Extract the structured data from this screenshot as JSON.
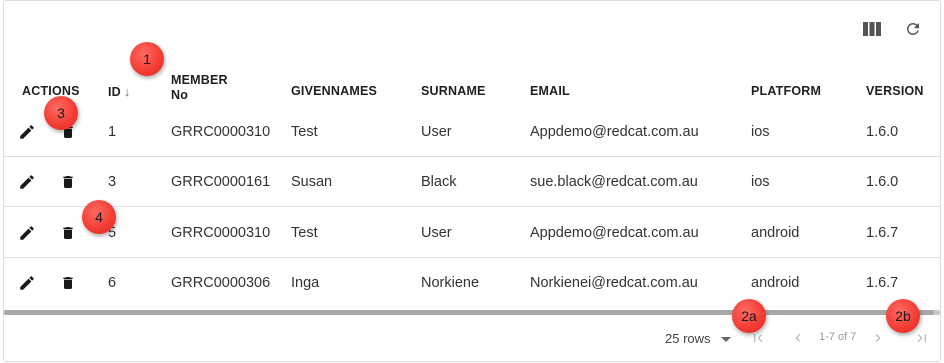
{
  "toolbar": {
    "columns_icon": "view-column-icon",
    "refresh_icon": "refresh-icon"
  },
  "headers": {
    "actions": "ACTIONS",
    "id": "ID",
    "id_sort": "↓",
    "member_line1": "MEMBER",
    "member_line2": "No",
    "givennames": "GIVENNAMES",
    "surname": "SURNAME",
    "email": "EMAIL",
    "platform": "PLATFORM",
    "version": "VERSION"
  },
  "rows": [
    {
      "id": "1",
      "member_no": "GRRC0000310",
      "givennames": "Test",
      "surname": "User",
      "email": "Appdemo@redcat.com.au",
      "platform": "ios",
      "version": "1.6.0"
    },
    {
      "id": "3",
      "member_no": "GRRC0000161",
      "givennames": "Susan",
      "surname": "Black",
      "email": "sue.black@redcat.com.au",
      "platform": "ios",
      "version": "1.6.0"
    },
    {
      "id": "5",
      "member_no": "GRRC0000310",
      "givennames": "Test",
      "surname": "User",
      "email": "Appdemo@redcat.com.au",
      "platform": "android",
      "version": "1.6.7"
    },
    {
      "id": "6",
      "member_no": "GRRC0000306",
      "givennames": "Inga",
      "surname": "Norkiene",
      "email": "Norkienei@redcat.com.au",
      "platform": "android",
      "version": "1.6.7"
    }
  ],
  "row_icons": {
    "edit": "pencil-icon",
    "delete": "trash-icon"
  },
  "pagination": {
    "rows_per_page": "25 rows",
    "page_info": "1-7 of 7"
  },
  "markers": {
    "m1": "1",
    "m2a": "2a",
    "m2b": "2b",
    "m3": "3",
    "m4": "4"
  },
  "colors": {
    "marker": "#f23a32",
    "icon": "#1a1a1a",
    "disabled_icon": "#bdbdbd",
    "divider": "#e0e0e0"
  }
}
